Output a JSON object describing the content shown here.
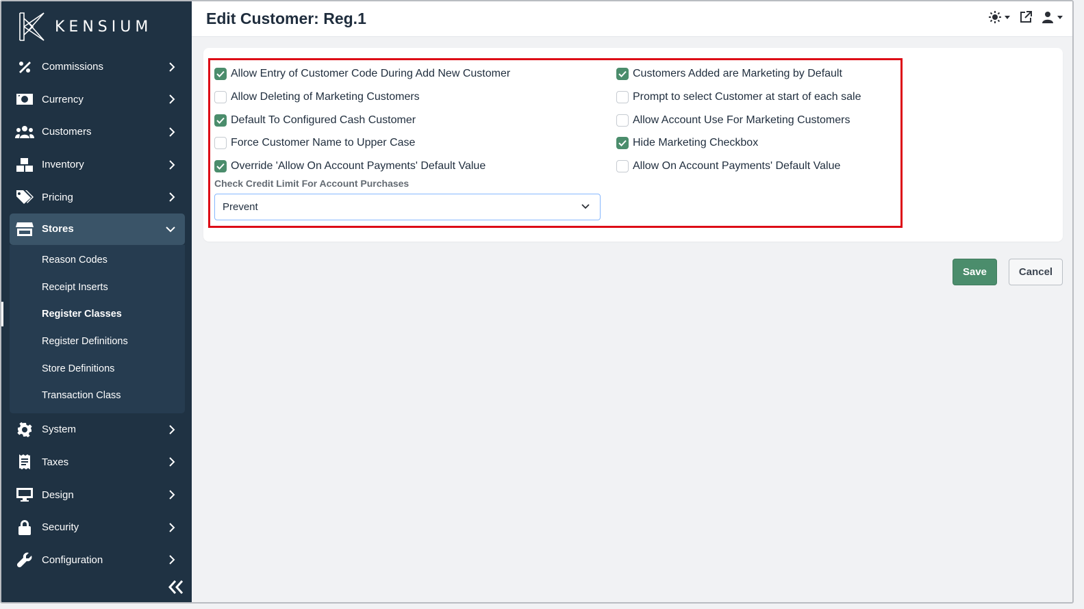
{
  "brand": {
    "name": "KENSIUM"
  },
  "header": {
    "title": "Edit Customer: Reg.1"
  },
  "sidebar": {
    "items": [
      {
        "label": "Commissions",
        "icon": "percent-icon"
      },
      {
        "label": "Currency",
        "icon": "money-bill-icon"
      },
      {
        "label": "Customers",
        "icon": "users-icon"
      },
      {
        "label": "Inventory",
        "icon": "boxes-icon"
      },
      {
        "label": "Pricing",
        "icon": "tags-icon"
      },
      {
        "label": "Stores",
        "icon": "store-icon",
        "expanded": true
      },
      {
        "label": "System",
        "icon": "gear-icon"
      },
      {
        "label": "Taxes",
        "icon": "receipt-icon"
      },
      {
        "label": "Design",
        "icon": "desktop-icon"
      },
      {
        "label": "Security",
        "icon": "lock-icon"
      },
      {
        "label": "Configuration",
        "icon": "wrench-icon"
      }
    ],
    "stores_submenu": [
      {
        "label": "Reason Codes"
      },
      {
        "label": "Receipt Inserts"
      },
      {
        "label": "Register Classes",
        "active": true
      },
      {
        "label": "Register Definitions"
      },
      {
        "label": "Store Definitions"
      },
      {
        "label": "Transaction Class"
      }
    ]
  },
  "settings": {
    "left": [
      {
        "label": "Allow Entry of Customer Code During Add New Customer",
        "checked": true
      },
      {
        "label": "Allow Deleting of Marketing Customers",
        "checked": false
      },
      {
        "label": "Default To Configured Cash Customer",
        "checked": true
      },
      {
        "label": "Force Customer Name to Upper Case",
        "checked": false
      },
      {
        "label": "Override 'Allow On Account Payments' Default Value",
        "checked": true
      }
    ],
    "right": [
      {
        "label": "Customers Added are Marketing by Default",
        "checked": true
      },
      {
        "label": "Prompt to select Customer at start of each sale",
        "checked": false
      },
      {
        "label": "Allow Account Use For Marketing Customers",
        "checked": false
      },
      {
        "label": "Hide Marketing Checkbox",
        "checked": true
      },
      {
        "label": "Allow On Account Payments' Default Value",
        "checked": false
      }
    ],
    "credit_limit": {
      "label": "Check Credit Limit For Account Purchases",
      "value": "Prevent"
    }
  },
  "actions": {
    "save_label": "Save",
    "cancel_label": "Cancel"
  },
  "colors": {
    "sidebar": "#1f3243",
    "accent": "#4b8d6c",
    "highlight": "#dd0b16"
  }
}
